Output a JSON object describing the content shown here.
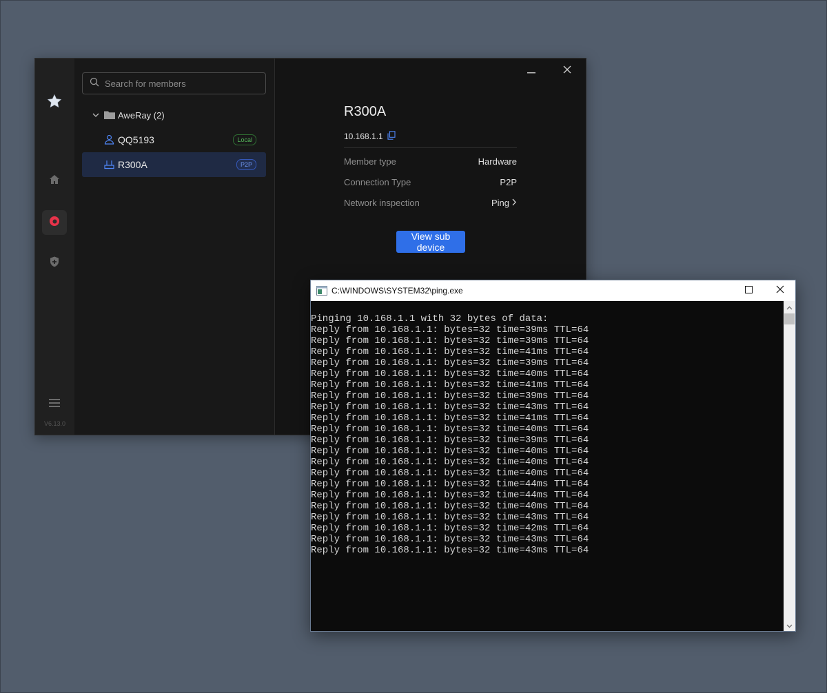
{
  "app": {
    "version": "V6.13.0",
    "search": {
      "placeholder": "Search for members",
      "value": ""
    },
    "group": {
      "label": "AweRay (2)"
    },
    "members": [
      {
        "name": "QQ5193",
        "badge": "Local",
        "icon": "user-icon"
      },
      {
        "name": "R300A",
        "badge": "P2P",
        "icon": "router-icon",
        "selected": true
      }
    ],
    "detail": {
      "title": "R300A",
      "ip": "10.168.1.1",
      "rows": [
        {
          "label": "Member type",
          "value": "Hardware"
        },
        {
          "label": "Connection Type",
          "value": "P2P"
        },
        {
          "label": "Network inspection",
          "value": "Ping"
        }
      ],
      "button_label": "View sub device"
    },
    "colors": {
      "accent": "#2f6fe8",
      "background": "#141414",
      "brand": "#e8334a"
    }
  },
  "console": {
    "title": "C:\\WINDOWS\\SYSTEM32\\ping.exe",
    "lines": [
      "Pinging 10.168.1.1 with 32 bytes of data:",
      "Reply from 10.168.1.1: bytes=32 time=39ms TTL=64",
      "Reply from 10.168.1.1: bytes=32 time=39ms TTL=64",
      "Reply from 10.168.1.1: bytes=32 time=41ms TTL=64",
      "Reply from 10.168.1.1: bytes=32 time=39ms TTL=64",
      "Reply from 10.168.1.1: bytes=32 time=40ms TTL=64",
      "Reply from 10.168.1.1: bytes=32 time=41ms TTL=64",
      "Reply from 10.168.1.1: bytes=32 time=39ms TTL=64",
      "Reply from 10.168.1.1: bytes=32 time=43ms TTL=64",
      "Reply from 10.168.1.1: bytes=32 time=41ms TTL=64",
      "Reply from 10.168.1.1: bytes=32 time=40ms TTL=64",
      "Reply from 10.168.1.1: bytes=32 time=39ms TTL=64",
      "Reply from 10.168.1.1: bytes=32 time=40ms TTL=64",
      "Reply from 10.168.1.1: bytes=32 time=40ms TTL=64",
      "Reply from 10.168.1.1: bytes=32 time=40ms TTL=64",
      "Reply from 10.168.1.1: bytes=32 time=44ms TTL=64",
      "Reply from 10.168.1.1: bytes=32 time=44ms TTL=64",
      "Reply from 10.168.1.1: bytes=32 time=40ms TTL=64",
      "Reply from 10.168.1.1: bytes=32 time=43ms TTL=64",
      "Reply from 10.168.1.1: bytes=32 time=42ms TTL=64",
      "Reply from 10.168.1.1: bytes=32 time=43ms TTL=64",
      "Reply from 10.168.1.1: bytes=32 time=43ms TTL=64"
    ]
  }
}
